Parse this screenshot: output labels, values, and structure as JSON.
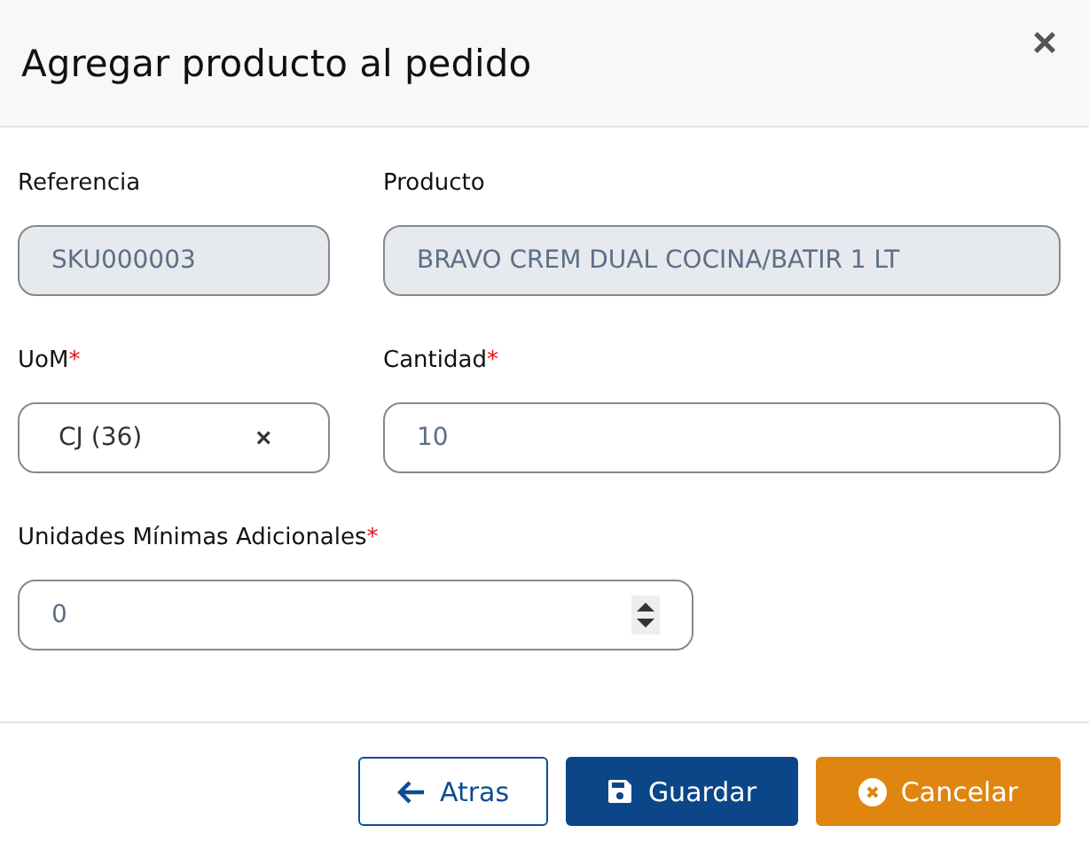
{
  "dialog": {
    "title": "Agregar producto al pedido",
    "close": "×"
  },
  "fields": [
    {
      "kind": "text",
      "label": "Referencia",
      "disabled": true,
      "value": "SKU000003"
    },
    {
      "kind": "text",
      "label": "Producto",
      "disabled": true,
      "value": "BRAVO CREM DUAL COCINA/BATIR 1 LT"
    },
    {
      "kind": "select",
      "label": "UoM",
      "required_mark": "*",
      "value": "CJ (36)",
      "clear": "×"
    },
    {
      "kind": "text",
      "label": "Cantidad",
      "required_mark": "*",
      "disabled": false,
      "value": "10"
    },
    {
      "kind": "number",
      "label": "Unidades Mínimas Adicionales",
      "required_mark": "*",
      "disabled": false,
      "value": "0"
    }
  ],
  "buttons": [
    {
      "kind": "back",
      "label": "Atras"
    },
    {
      "kind": "save",
      "label": "Guardar"
    },
    {
      "kind": "cancel",
      "label": "Cancelar"
    }
  ]
}
